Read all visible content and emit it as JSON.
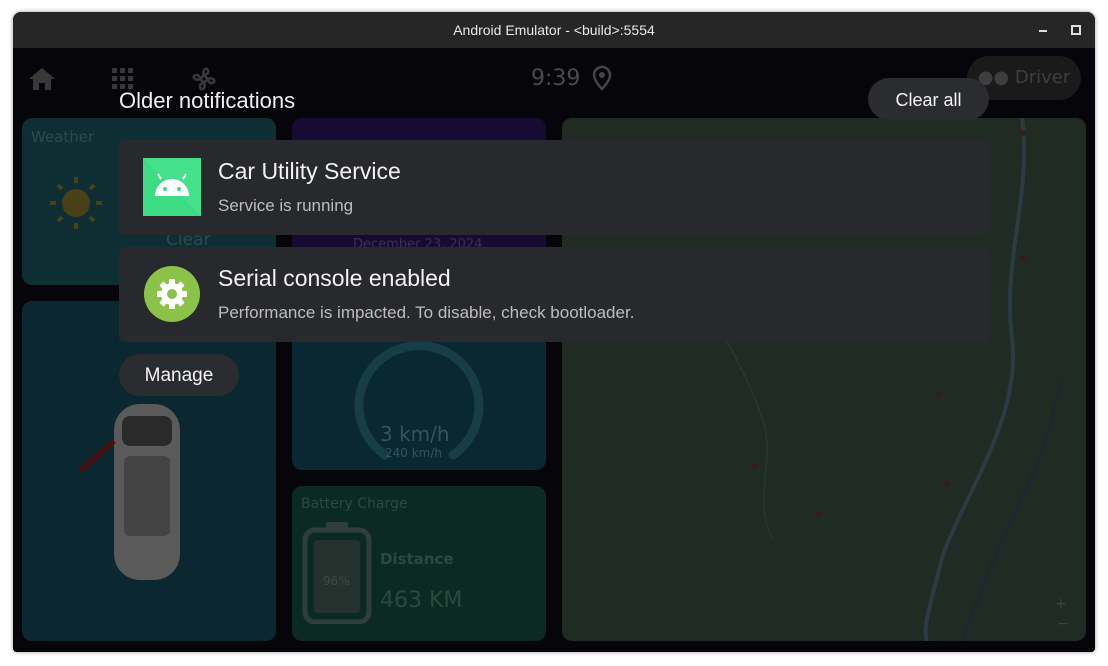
{
  "window": {
    "title": "Android Emulator - <build>:5554"
  },
  "statusbar": {
    "time": "9:39",
    "driver_label": "Driver"
  },
  "background": {
    "weather_label": "Weather",
    "weather_condition": "Clear",
    "date": "December 23, 2024",
    "speed": "3 km/h",
    "speed_max": "240 km/h",
    "battery_label": "Battery Charge",
    "battery_percent": "96%",
    "distance_label": "Distance",
    "distance_value": "463 KM"
  },
  "notifications": {
    "header": "Older notifications",
    "clear_all": "Clear all",
    "manage": "Manage",
    "items": [
      {
        "icon": "android-icon",
        "title": "Car Utility Service",
        "text": "Service is running"
      },
      {
        "icon": "gear-icon",
        "title": "Serial console enabled",
        "text": "Performance is impacted. To disable, check bootloader."
      }
    ]
  },
  "colors": {
    "card_bg": "#28292d",
    "button_bg": "#2b2c30",
    "android_green": "#3ddc84",
    "gear_green": "#8bc34a"
  }
}
